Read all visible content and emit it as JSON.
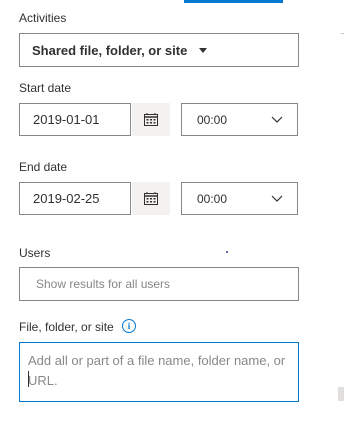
{
  "activities": {
    "label": "Activities",
    "selected": "Shared file, folder, or site"
  },
  "start_date": {
    "label": "Start date",
    "date": "2019-01-01",
    "time": "00:00"
  },
  "end_date": {
    "label": "End date",
    "date": "2019-02-25",
    "time": "00:00"
  },
  "users": {
    "label": "Users",
    "placeholder": "Show results for all users"
  },
  "file": {
    "label": "File, folder, or site",
    "info_glyph": "i",
    "placeholder": "Add all or part of a file name, folder name, or URL."
  },
  "colors": {
    "accent": "#0078d4",
    "border": "#8a8886",
    "button_bg": "#f3f2f1"
  }
}
